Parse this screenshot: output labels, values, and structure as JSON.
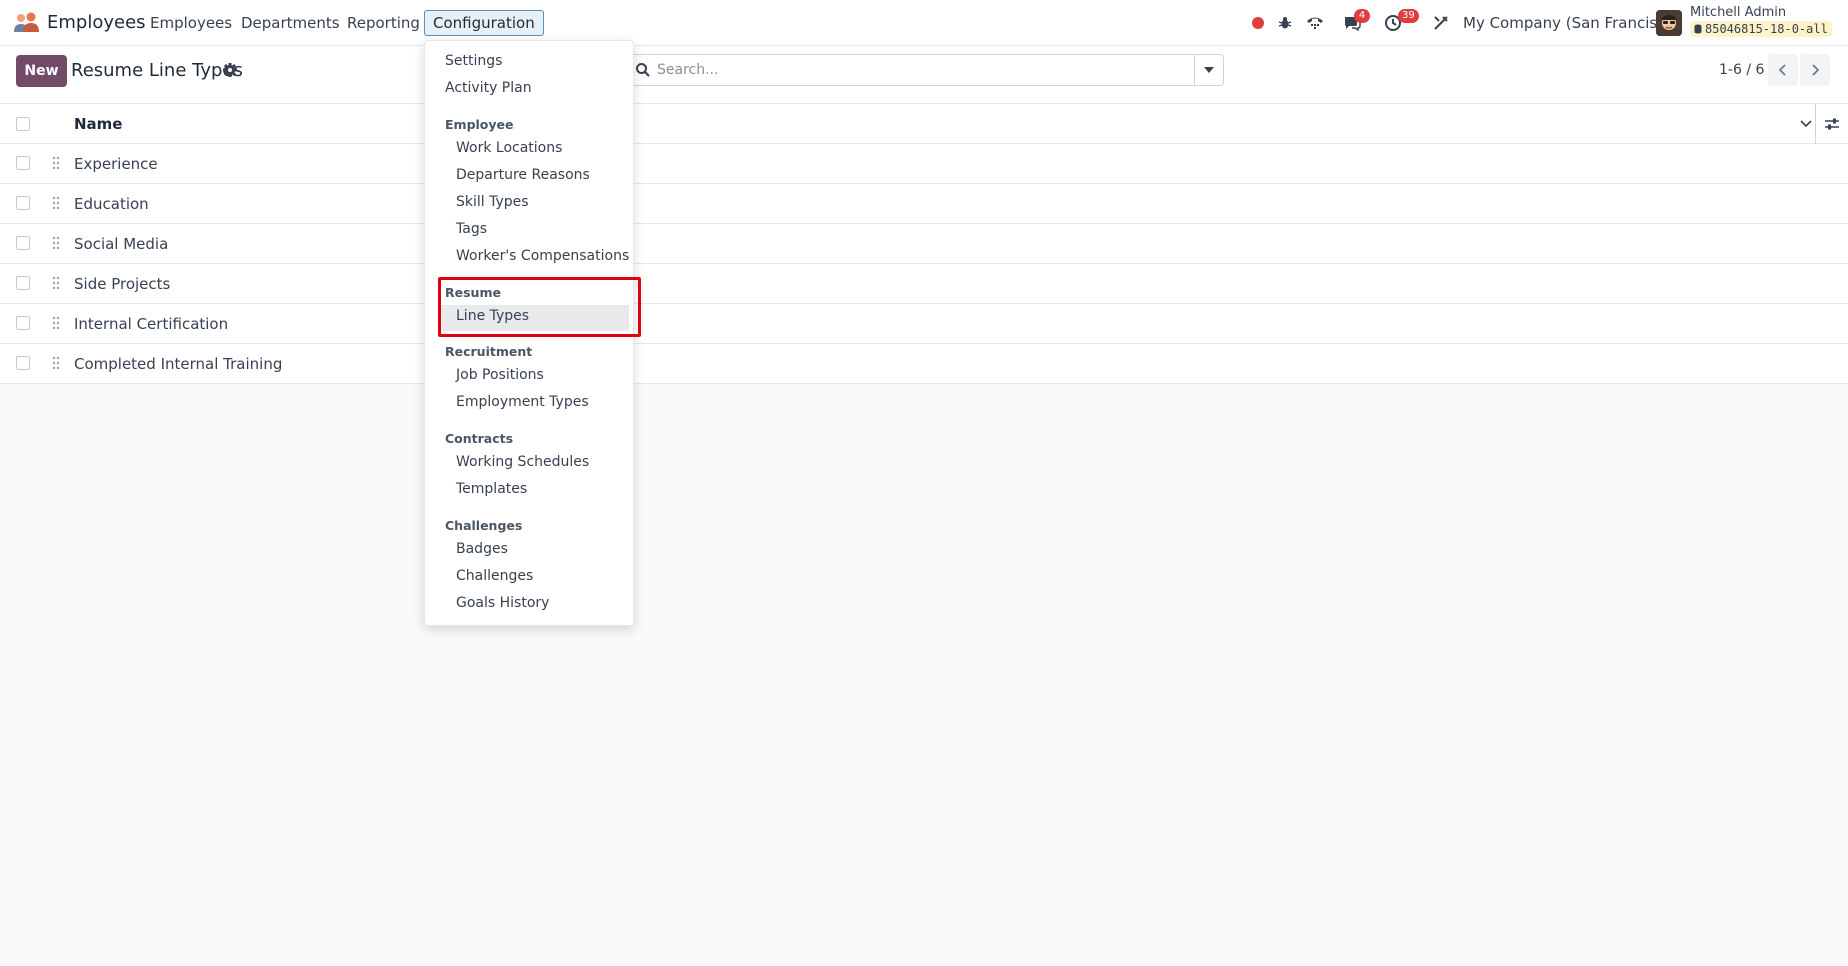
{
  "navbar": {
    "app_name": "Employees",
    "menu": [
      "Employees",
      "Departments",
      "Reporting",
      "Configuration"
    ],
    "active_menu": "Configuration",
    "messages_count": "4",
    "activities_count": "39",
    "company": "My Company (San Francisco)",
    "user_name": "Mitchell Admin",
    "database": "85046815-18-0-all"
  },
  "control_panel": {
    "new_label": "New",
    "title": "Resume Line Types",
    "search_placeholder": "Search...",
    "pager": "1-6 / 6"
  },
  "list": {
    "column": "Name",
    "rows": [
      "Experience",
      "Education",
      "Social Media",
      "Side Projects",
      "Internal Certification",
      "Completed Internal Training"
    ]
  },
  "dropdown": {
    "settings": "Settings",
    "activity_plan": "Activity Plan",
    "sections": [
      {
        "title": "Employee",
        "items": [
          "Work Locations",
          "Departure Reasons",
          "Skill Types",
          "Tags",
          "Worker's Compensations"
        ]
      },
      {
        "title": "Resume",
        "items": [
          "Line Types"
        ]
      },
      {
        "title": "Recruitment",
        "items": [
          "Job Positions",
          "Employment Types"
        ]
      },
      {
        "title": "Contracts",
        "items": [
          "Working Schedules",
          "Templates"
        ]
      },
      {
        "title": "Challenges",
        "items": [
          "Badges",
          "Challenges",
          "Goals History"
        ]
      }
    ],
    "highlighted_item": "Line Types"
  },
  "colors": {
    "brand": "#714b67",
    "badge": "#e03e3e",
    "annotation": "#e0000f"
  }
}
